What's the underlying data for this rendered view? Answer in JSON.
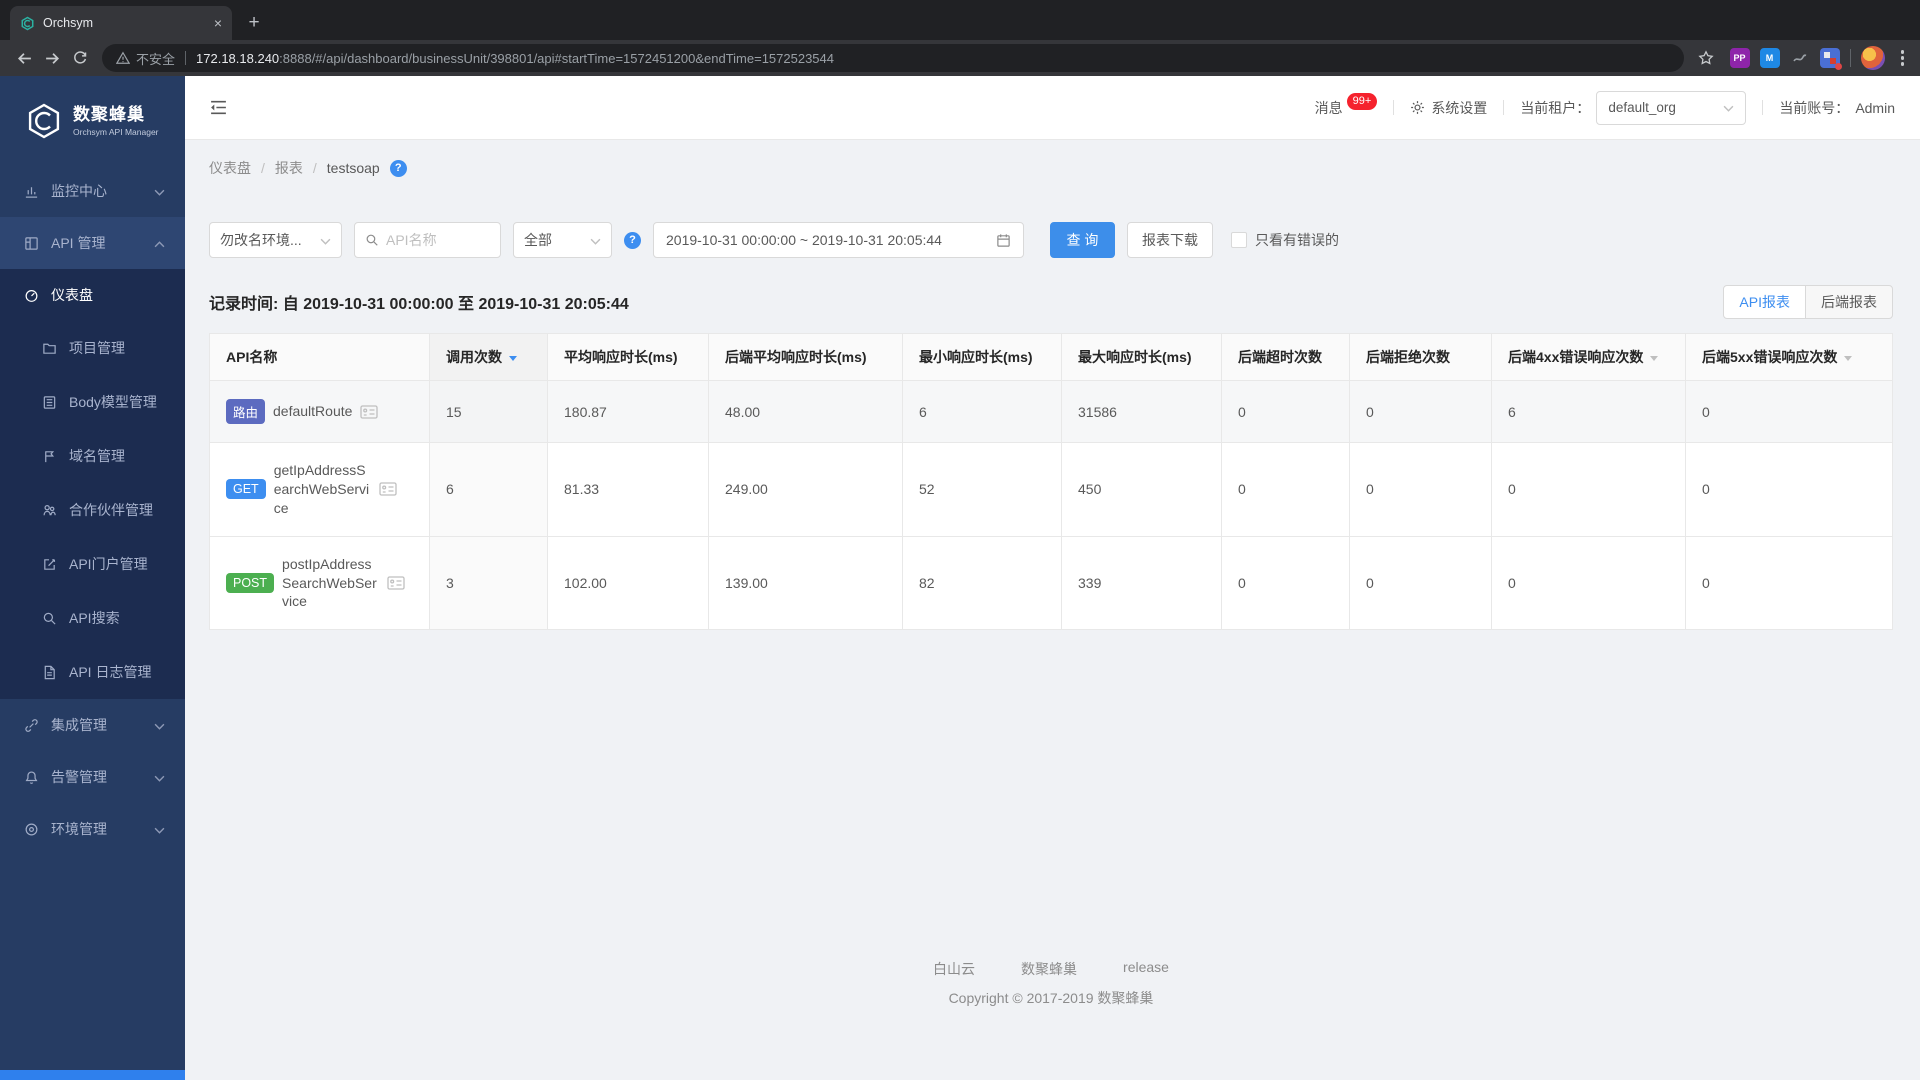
{
  "browser": {
    "tab_title": "Orchsym",
    "url_security": "不安全",
    "url_host": "172.18.18.240",
    "url_rest": ":8888/#/api/dashboard/businessUnit/398801/api#startTime=1572451200&endTime=1572523544",
    "extensions": [
      {
        "label": "PP",
        "bg": "#8e24aa"
      },
      {
        "label": "M",
        "bg": "#1e88e5"
      },
      {
        "label": "",
        "bg": "#3a3d42"
      },
      {
        "label": "",
        "bg": "#4a6fd4"
      }
    ]
  },
  "sidebar": {
    "brand": {
      "title": "数聚蜂巢",
      "subtitle": "Orchsym API Manager"
    },
    "items": [
      {
        "key": "monitor-center",
        "label": "监控中心",
        "icon": "bar-chart-icon",
        "type": "group",
        "chevron": "down"
      },
      {
        "key": "api-management",
        "label": "API 管理",
        "icon": "grid-icon",
        "type": "group-open",
        "chevron": "up"
      },
      {
        "key": "dashboard",
        "label": "仪表盘",
        "icon": "gauge-icon",
        "type": "sub-active"
      },
      {
        "key": "project-management",
        "label": "项目管理",
        "icon": "folder-icon",
        "type": "sub"
      },
      {
        "key": "body-model-management",
        "label": "Body模型管理",
        "icon": "list-icon",
        "type": "sub"
      },
      {
        "key": "domain-management",
        "label": "域名管理",
        "icon": "flag-icon",
        "type": "sub"
      },
      {
        "key": "partner-management",
        "label": "合作伙伴管理",
        "icon": "partners-icon",
        "type": "sub"
      },
      {
        "key": "api-portal-management",
        "label": "API门户管理",
        "icon": "edit-icon",
        "type": "sub"
      },
      {
        "key": "api-search",
        "label": "API搜索",
        "icon": "search-icon",
        "type": "sub"
      },
      {
        "key": "api-log-management",
        "label": "API 日志管理",
        "icon": "file-icon",
        "type": "sub"
      },
      {
        "key": "integration-management",
        "label": "集成管理",
        "icon": "link-icon",
        "type": "group",
        "chevron": "down"
      },
      {
        "key": "alert-management",
        "label": "告警管理",
        "icon": "bell-icon",
        "type": "group",
        "chevron": "down"
      },
      {
        "key": "environment-management",
        "label": "环境管理",
        "icon": "target-icon",
        "type": "group",
        "chevron": "down"
      }
    ]
  },
  "header": {
    "message_label": "消息",
    "message_count": "99+",
    "settings_label": "系统设置",
    "tenant_label": "当前租户：",
    "tenant_value": "default_org",
    "account_label": "当前账号：",
    "account_value": "Admin"
  },
  "breadcrumb": {
    "items": [
      "仪表盘",
      "报表",
      "testsoap"
    ],
    "separator": "/"
  },
  "filters": {
    "env_value": "勿改名环境...",
    "search_placeholder": "API名称",
    "scope_value": "全部",
    "date_range": "2019-10-31 00:00:00 ~ 2019-10-31 20:05:44",
    "query_label": "查 询",
    "download_label": "报表下载",
    "errors_only_label": "只看有错误的"
  },
  "report": {
    "record_time": "记录时间: 自 2019-10-31 00:00:00 至 2019-10-31 20:05:44",
    "tabs": [
      {
        "label": "API报表",
        "active": true
      },
      {
        "label": "后端报表",
        "active": false
      }
    ],
    "table": {
      "columns": [
        {
          "label": "API名称"
        },
        {
          "label": "调用次数",
          "sort": "active"
        },
        {
          "label": "平均响应时长(ms)"
        },
        {
          "label": "后端平均响应时长(ms)"
        },
        {
          "label": "最小响应时长(ms)"
        },
        {
          "label": "最大响应时长(ms)"
        },
        {
          "label": "后端超时次数"
        },
        {
          "label": "后端拒绝次数"
        },
        {
          "label": "后端4xx错误响应次数",
          "sort": "inactive"
        },
        {
          "label": "后端5xx错误响应次数",
          "sort": "inactive"
        }
      ],
      "rows": [
        {
          "badge": "路由",
          "badge_color": "#5c6bc0",
          "name": "defaultRoute",
          "values": [
            "15",
            "180.87",
            "48.00",
            "6",
            "31586",
            "0",
            "0",
            "6",
            "0"
          ],
          "highlight": true
        },
        {
          "badge": "GET",
          "badge_color": "#3d8ef0",
          "name": "getIpAddressSearchWebService",
          "values": [
            "6",
            "81.33",
            "249.00",
            "52",
            "450",
            "0",
            "0",
            "0",
            "0"
          ],
          "highlight": false
        },
        {
          "badge": "POST",
          "badge_color": "#4caf50",
          "name": "postIpAddressSearchWebService",
          "values": [
            "3",
            "102.00",
            "139.00",
            "82",
            "339",
            "0",
            "0",
            "0",
            "0"
          ],
          "highlight": false
        }
      ]
    }
  },
  "footer": {
    "links": [
      "白山云",
      "数聚蜂巢",
      "release"
    ],
    "copyright": "Copyright © 2017-2019 数聚蜂巢"
  },
  "colors": {
    "accent": "#3d8ef0",
    "sidebar": "#263c63",
    "sidebar_submenu": "#1c2c50",
    "badge_route": "#5c6bc0",
    "badge_get": "#3d8ef0",
    "badge_post": "#4caf50",
    "danger_badge": "#f5222d"
  }
}
